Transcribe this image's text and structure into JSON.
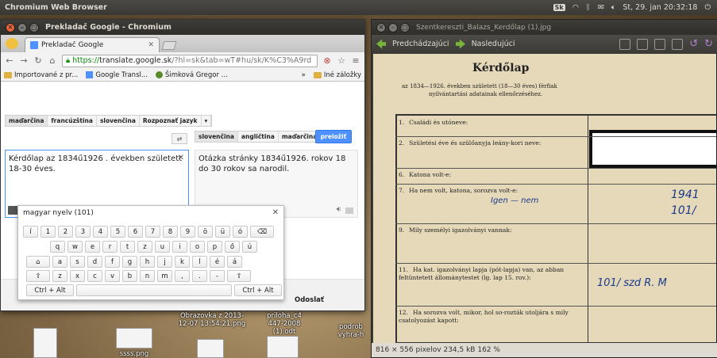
{
  "topbar": {
    "app_name": "Chromium Web Browser",
    "kbd_layout": "Sk",
    "date_time": "St, 29. jan  20:32:18"
  },
  "chrome": {
    "window_title": "Prekladač Google - Chromium",
    "tab_title": "Prekladač Google",
    "url_https": "https://",
    "url_host": "translate.google.sk",
    "url_rest": "/?hl=sk&tab=wT#hu/sk/K%C3%A9rd",
    "bookmarks": [
      {
        "label": "Importované z pr..."
      },
      {
        "label": "Google Transl..."
      },
      {
        "label": "Šimková Gregor ..."
      }
    ],
    "other_bookmarks": "Iné záložky",
    "overflow": "»"
  },
  "translate": {
    "source_langs": [
      "maďarčina",
      "francúzština",
      "slovenčina",
      "Rozpoznať jazyk"
    ],
    "target_langs": [
      "slovenčina",
      "angličtina",
      "maďarčina"
    ],
    "translate_button": "preložiť",
    "source_text": "Kérdőlap az  1834ű1926 . években született 18-30 éves.",
    "target_text": "Otázka stránky 1834ű1926. rokov 18 do 30 rokov sa narodil.",
    "send_label": "Odoslať",
    "clear_symbol": "✕"
  },
  "keyboard": {
    "title": "magyar nyelv (101)",
    "row1": [
      "í",
      "1",
      "2",
      "3",
      "4",
      "5",
      "6",
      "7",
      "8",
      "9",
      "ö",
      "ü",
      "ó",
      "⌫"
    ],
    "row2": [
      "q",
      "w",
      "e",
      "r",
      "t",
      "z",
      "u",
      "i",
      "o",
      "p",
      "ő",
      "ú"
    ],
    "row3": [
      "⌂",
      "a",
      "s",
      "d",
      "f",
      "g",
      "h",
      "j",
      "k",
      "l",
      "é",
      "á"
    ],
    "row4": [
      "⇧",
      "z",
      "x",
      "c",
      "v",
      "b",
      "n",
      "m",
      ",",
      ".",
      "-",
      "⇧"
    ],
    "row5": [
      "Ctrl + Alt",
      "Ctrl + Alt"
    ]
  },
  "viewer": {
    "title": "Szentkereszti_Balazs_Kerdőlap (1).jpg",
    "prev_label": "Predchádzajúci",
    "next_label": "Nasledujúci",
    "status": "816 × 556 pixelov  234,5 kB   162 %"
  },
  "document": {
    "heading": "Kérdőlap",
    "subtitle1": "az 1834—1926. években született (18—30 éves) férfiak",
    "subtitle2": "nyilvántartási adatainak ellenőrzéséhez.",
    "rows": [
      {
        "num": "1.",
        "text": "Családi és utóneve:"
      },
      {
        "num": "2.",
        "text": "Születési éve és szülőanyja leány-kori neve:"
      },
      {
        "num": "6.",
        "text": "Katona volt-e:"
      },
      {
        "num": "7.",
        "text": "Ha nem volt, katona, sorozva volt-e:"
      },
      {
        "num": "9.",
        "text": "Mily személyi igazolványi vannak:"
      },
      {
        "num": "11.",
        "text": "Ha kat. igazolványi lapja (pót-lapja) van, az abban feltüntetett állománytestet (lg. lap 15. rov.):"
      },
      {
        "num": "12.",
        "text": "Ha sorozva volt, mikor, hol so-rozták utoljára s mily csatolyozást kapott:"
      }
    ]
  },
  "desktop": {
    "icons": [
      {
        "label": "ssss.png"
      },
      {
        "label": "Obrazovka z 2013-12-07 13:54:21.png"
      },
      {
        "label": "priloha_c4 447-2008 (1).odt"
      },
      {
        "label": "podrob vyhra-h"
      }
    ]
  }
}
